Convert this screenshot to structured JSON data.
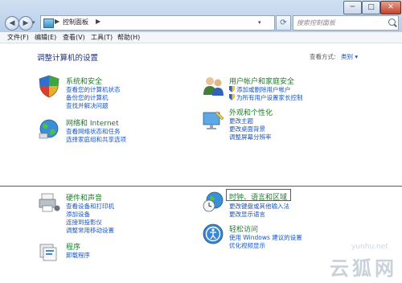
{
  "window": {
    "title_buttons": {
      "minimize": "─",
      "maximize": "□",
      "close": "✕"
    }
  },
  "nav": {
    "back": "◀",
    "forward": "▶",
    "history_dropdown": "▾"
  },
  "address": {
    "separator": "▶",
    "path": "控制面板",
    "dropdown": "▾"
  },
  "refresh": {
    "icon": "refresh-icon",
    "glyph": "⟳"
  },
  "search": {
    "placeholder": "搜索控制面板"
  },
  "menu": {
    "items": [
      "文件(F)",
      "编辑(E)",
      "查看(V)",
      "工具(T)",
      "帮助(H)"
    ]
  },
  "page": {
    "title": "调整计算机的设置",
    "view_by_label": "查看方式:",
    "view_by_value": "类别 ▾"
  },
  "categories": {
    "system_security": {
      "title": "系统和安全",
      "links": [
        "查看您的计算机状态",
        "备份您的计算机",
        "查找并解决问题"
      ]
    },
    "network": {
      "title": "网络和 Internet",
      "links": [
        "查看网络状态和任务",
        "选择家庭组和共享选项"
      ]
    },
    "hardware_sound": {
      "title": "硬件和声音",
      "links": [
        "查看设备和打印机",
        "添加设备",
        "连接到投影仪",
        "调整常用移动设置"
      ]
    },
    "programs": {
      "title": "程序",
      "links": [
        "卸载程序"
      ]
    },
    "user_accounts": {
      "title": "用户帐户和家庭安全",
      "links": [
        "添加或删除用户帐户",
        "为所有用户设置家长控制"
      ]
    },
    "appearance": {
      "title": "外观和个性化",
      "links": [
        "更改主题",
        "更改桌面背景",
        "调整屏幕分辨率"
      ]
    },
    "clock_region": {
      "title": "时钟、语言和区域",
      "links": [
        "更改键盘或其他输入法",
        "更改显示语言"
      ]
    },
    "ease_of_access": {
      "title": "轻松访问",
      "links": [
        "使用 Windows 建议的设置",
        "优化视频显示"
      ]
    }
  },
  "watermark": {
    "site": "yunhu.net",
    "name": "云狐网"
  },
  "colors": {
    "link_blue": "#1a55c2",
    "category_green": "#1f7a2c",
    "highlight_red": "#d02828"
  }
}
